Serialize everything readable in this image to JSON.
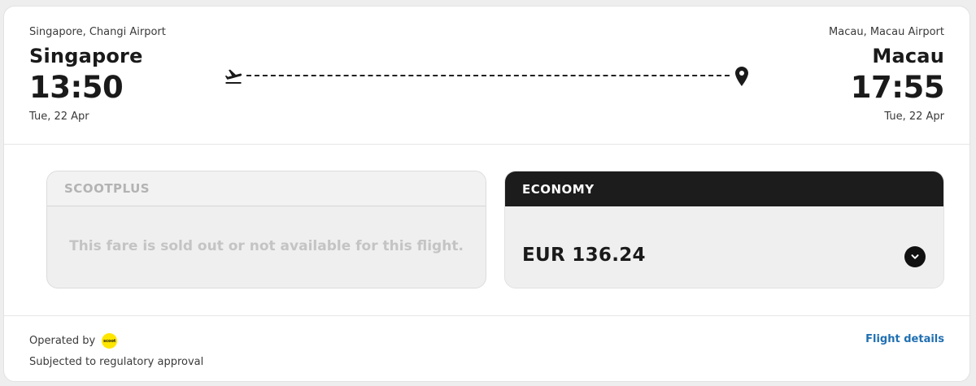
{
  "origin": {
    "airport": "Singapore, Changi Airport",
    "city": "Singapore",
    "time": "13:50",
    "date": "Tue, 22 Apr"
  },
  "destination": {
    "airport": "Macau, Macau Airport",
    "city": "Macau",
    "time": "17:55",
    "date": "Tue, 22 Apr"
  },
  "icons": {
    "departure": "plane-takeoff-icon",
    "arrival": "location-pin-icon",
    "expand": "chevron-down-icon"
  },
  "fares": {
    "scootplus": {
      "label": "SCOOTPLUS",
      "message": "This fare is sold out or not available for this flight."
    },
    "economy": {
      "label": "ECONOMY",
      "price": "EUR 136.24"
    }
  },
  "footer": {
    "operated_by": "Operated by",
    "airline_logo_text": "scoot",
    "regulatory": "Subjected to regulatory approval",
    "details_link": "Flight details"
  },
  "colors": {
    "accent_link": "#1f6fb2",
    "economy_header": "#1c1c1c",
    "scoot_yellow": "#ffe600"
  }
}
